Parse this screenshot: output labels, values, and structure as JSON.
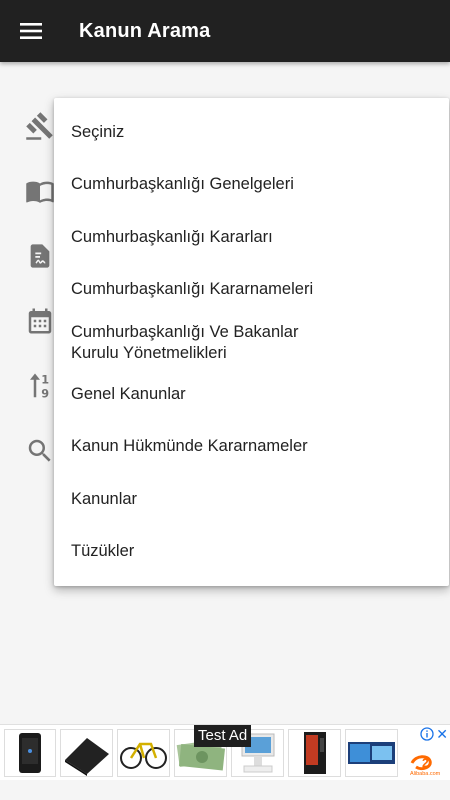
{
  "app": {
    "title": "Kanun Arama"
  },
  "colors": {
    "appbar": "#212121",
    "icon_gray": "#757575",
    "ad_accent": "#ff6a00"
  },
  "side_icons": [
    {
      "name": "gavel-icon"
    },
    {
      "name": "book-icon"
    },
    {
      "name": "document-signature-icon"
    },
    {
      "name": "calendar-icon"
    },
    {
      "name": "sort-numeric-icon"
    },
    {
      "name": "search-icon"
    }
  ],
  "dropdown": {
    "options": [
      "Seçiniz",
      "Cumhurbaşkanlığı Genelgeleri",
      "Cumhurbaşkanlığı Kararları",
      "Cumhurbaşkanlığı Kararnameleri",
      "Cumhurbaşkanlığı Ve Bakanlar Kurulu Yönetmelikleri",
      "Genel Kanunlar",
      "Kanun Hükmünde Kararnameler",
      "Kanunlar",
      "Tüzükler"
    ]
  },
  "ad": {
    "label": "Test Ad",
    "info_icon": "info-icon",
    "close_icon": "close-icon",
    "logo_text": "Alibaba.com"
  }
}
